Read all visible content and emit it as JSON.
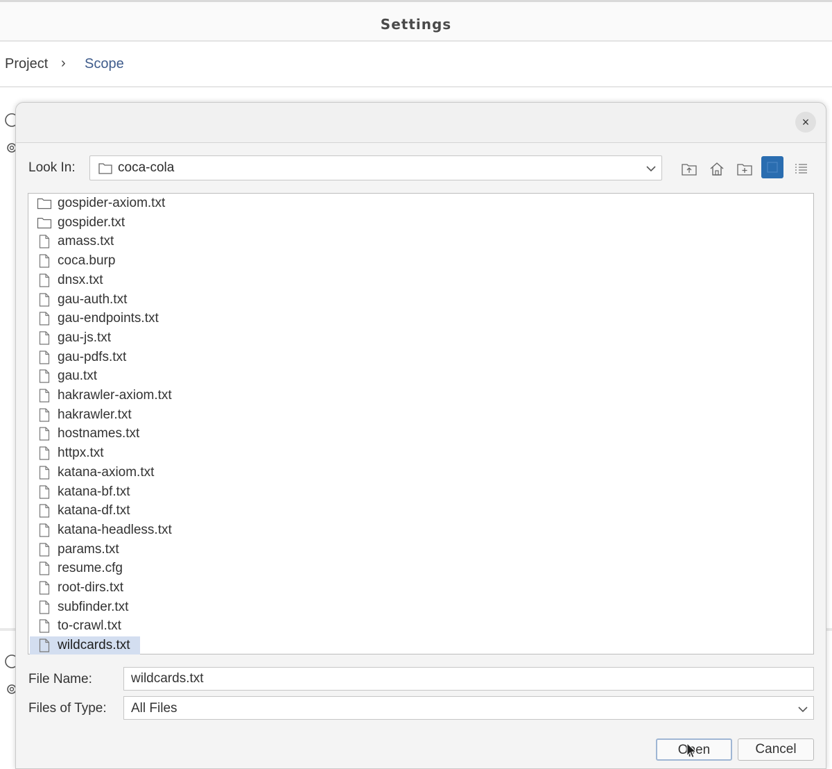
{
  "settings": {
    "title": "Settings"
  },
  "breadcrumb": {
    "project": "Project",
    "separator": "›",
    "scope": "Scope"
  },
  "dialog": {
    "close_symbol": "×",
    "look_in": {
      "label": "Look In:",
      "value": "coca-cola"
    },
    "toolbar": [
      "up-one-level-icon",
      "home-icon",
      "new-folder-icon",
      "list-view-icon",
      "details-view-icon"
    ],
    "files": [
      {
        "name": "gospider-axiom.txt",
        "type": "folder"
      },
      {
        "name": "gospider.txt",
        "type": "folder"
      },
      {
        "name": "amass.txt",
        "type": "file"
      },
      {
        "name": "coca.burp",
        "type": "file"
      },
      {
        "name": "dnsx.txt",
        "type": "file"
      },
      {
        "name": "gau-auth.txt",
        "type": "file"
      },
      {
        "name": "gau-endpoints.txt",
        "type": "file"
      },
      {
        "name": "gau-js.txt",
        "type": "file"
      },
      {
        "name": "gau-pdfs.txt",
        "type": "file"
      },
      {
        "name": "gau.txt",
        "type": "file"
      },
      {
        "name": "hakrawler-axiom.txt",
        "type": "file"
      },
      {
        "name": "hakrawler.txt",
        "type": "file"
      },
      {
        "name": "hostnames.txt",
        "type": "file"
      },
      {
        "name": "httpx.txt",
        "type": "file"
      },
      {
        "name": "katana-axiom.txt",
        "type": "file"
      },
      {
        "name": "katana-bf.txt",
        "type": "file"
      },
      {
        "name": "katana-df.txt",
        "type": "file"
      },
      {
        "name": "katana-headless.txt",
        "type": "file"
      },
      {
        "name": "params.txt",
        "type": "file"
      },
      {
        "name": "resume.cfg",
        "type": "file"
      },
      {
        "name": "root-dirs.txt",
        "type": "file"
      },
      {
        "name": "subfinder.txt",
        "type": "file"
      },
      {
        "name": "to-crawl.txt",
        "type": "file"
      },
      {
        "name": "wildcards.txt",
        "type": "file",
        "selected": true
      }
    ],
    "file_name": {
      "label": "File Name:",
      "value": "wildcards.txt"
    },
    "files_of_type": {
      "label": "Files of Type:",
      "value": "All Files"
    },
    "buttons": {
      "open": "Open",
      "cancel": "Cancel"
    }
  },
  "colors": {
    "accent": "#2a6db0",
    "selection": "#d3def0",
    "link": "#3f5c8c"
  }
}
